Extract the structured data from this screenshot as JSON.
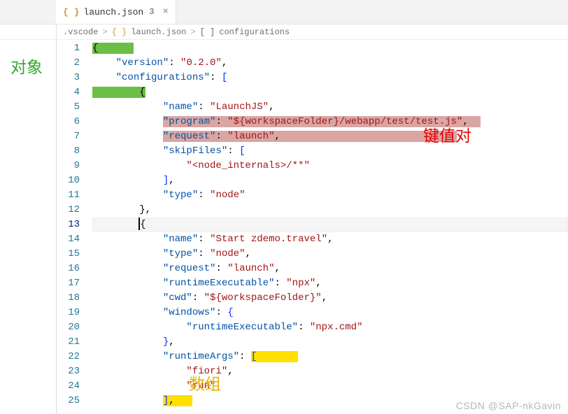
{
  "tab": {
    "icon": "{ }",
    "filename": "launch.json",
    "modified_indicator": "3",
    "close": "×"
  },
  "breadcrumb": {
    "folder": ".vscode",
    "sep": ">",
    "file_icon": "{ }",
    "file": "launch.json",
    "section_icon": "[ ]",
    "section": "configurations"
  },
  "annotations": {
    "object": "对象",
    "kvpair": "键值对",
    "array": "数组"
  },
  "watermark": "CSDN @SAP-nkGavin",
  "code": {
    "l1": "{",
    "l2_key": "\"version\"",
    "l2_val": "\"0.2.0\"",
    "l3_key": "\"configurations\"",
    "l4": "{",
    "l5_key": "\"name\"",
    "l5_val": "\"LaunchJS\"",
    "l6_key": "\"program\"",
    "l6_val": "\"${workspaceFolder}/webapp/test/test.js\"",
    "l7_key": "\"request\"",
    "l7_val": "\"launch\"",
    "l8_key": "\"skipFiles\"",
    "l9_val": "\"<node_internals>/**\"",
    "l10": "],",
    "l11_key": "\"type\"",
    "l11_val": "\"node\"",
    "l12": "},",
    "l13": "{",
    "l14_key": "\"name\"",
    "l14_val": "\"Start zdemo.travel\"",
    "l15_key": "\"type\"",
    "l15_val": "\"node\"",
    "l16_key": "\"request\"",
    "l16_val": "\"launch\"",
    "l17_key": "\"runtimeExecutable\"",
    "l17_val": "\"npx\"",
    "l18_key": "\"cwd\"",
    "l18_val": "\"${workspaceFolder}\"",
    "l19_key": "\"windows\"",
    "l20_key": "\"runtimeExecutable\"",
    "l20_val": "\"npx.cmd\"",
    "l21": "},",
    "l22_key": "\"runtimeArgs\"",
    "l23_val": "\"fiori\"",
    "l24_val": "\"run\"",
    "l25": "],"
  },
  "active_line": 13
}
